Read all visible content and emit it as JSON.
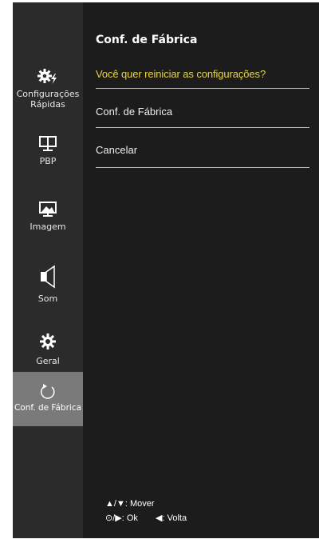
{
  "sidebar": {
    "items": [
      {
        "label": "Configurações\nRápidas",
        "icon": "quick-settings-icon"
      },
      {
        "label": "PBP",
        "icon": "pbp-icon"
      },
      {
        "label": "Imagem",
        "icon": "picture-icon"
      },
      {
        "label": "Som",
        "icon": "speaker-icon"
      },
      {
        "label": "Geral",
        "icon": "gear-icon"
      },
      {
        "label": "Conf. de Fábrica",
        "icon": "reset-icon",
        "selected": true
      }
    ]
  },
  "panel": {
    "title": "Conf. de Fábrica",
    "question": "Você quer reiniciar as configurações?",
    "options": [
      "Conf. de Fábrica",
      "Cancelar"
    ]
  },
  "help": {
    "move_keys": "▲/▼:",
    "move_label": "Mover",
    "ok_keys": "⊙/▶:",
    "ok_label": "Ok",
    "back_keys": "◀:",
    "back_label": "Volta"
  },
  "colors": {
    "background": "#1c1c1c",
    "sidebar": "#2b2b2b",
    "selected": "#7a7a7a",
    "question": "#e8d34a"
  }
}
